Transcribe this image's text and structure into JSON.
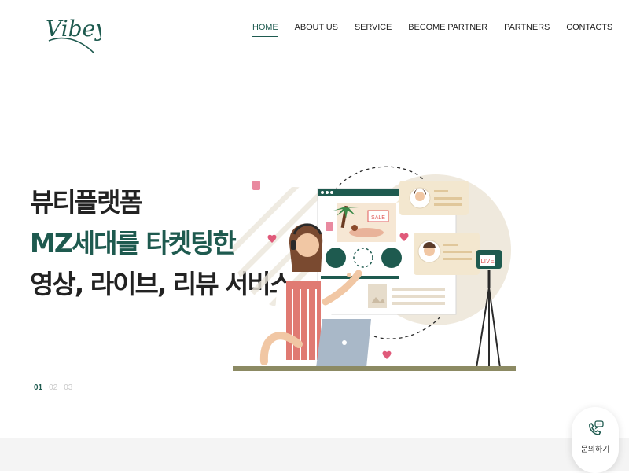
{
  "brand": {
    "logo_text": "Vibey",
    "accent_color": "#1e5a4f"
  },
  "nav": {
    "items": [
      {
        "label": "HOME",
        "active": true
      },
      {
        "label": "ABOUT US",
        "active": false
      },
      {
        "label": "SERVICE",
        "active": false
      },
      {
        "label": "BECOME PARTNER",
        "active": false
      },
      {
        "label": "PARTNERS",
        "active": false
      },
      {
        "label": "CONTACTS",
        "active": false
      }
    ]
  },
  "hero": {
    "line1": "뷰티플랫폼",
    "line2": "MZ세대를 타켓팅한",
    "line3": "영상, 라이브, 리뷰 서비스",
    "illustration": {
      "sale_tag": "SALE",
      "live_tag": "LIVE"
    }
  },
  "slider": {
    "pages": [
      "01",
      "02",
      "03"
    ],
    "current_index": 0
  },
  "floating_inquiry": {
    "icon": "phone-chat-icon",
    "label": "문의하기"
  }
}
